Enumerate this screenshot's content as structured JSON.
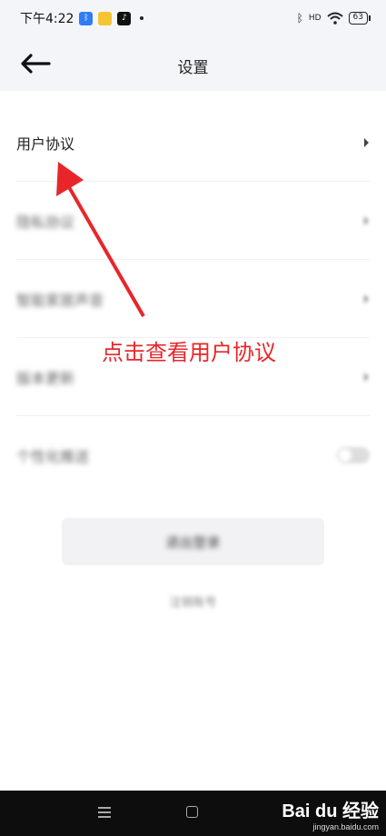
{
  "status_bar": {
    "time": "下午4:22",
    "battery": "63",
    "signal_label": "HD"
  },
  "header": {
    "title": "设置"
  },
  "settings": {
    "items": [
      {
        "label": "用户协议",
        "control": "chevron"
      },
      {
        "label": "隐私协议",
        "control": "chevron"
      },
      {
        "label": "智能家居声音",
        "control": "chevron"
      },
      {
        "label": "版本更新",
        "control": "chevron"
      },
      {
        "label": "个性化推送",
        "control": "toggle"
      }
    ]
  },
  "actions": {
    "logout_label": "退出登录",
    "cancel_account_label": "注销账号"
  },
  "annotation": {
    "text": "点击查看用户协议",
    "color": "#e8262a"
  },
  "watermark": {
    "main": "Bai du 经验",
    "sub": "jingyan.baidu.com"
  },
  "colors": {
    "header_bg": "#f4f5f8",
    "nav_bg": "#0d0d0d"
  }
}
